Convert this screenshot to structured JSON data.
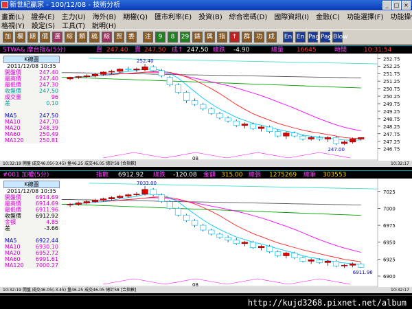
{
  "window": {
    "title": "新世紀贏家 - 100/12/08 - 技術分析",
    "buttons": [
      "_",
      "□",
      "×"
    ]
  },
  "menu": {
    "row1": [
      "畫面(L)",
      "證券(E)",
      "主力(U)",
      "海外(B)",
      "期權(Q)",
      "匯市利率(E)",
      "投資(B)",
      "綜合密碼(D)",
      "國際資訊(I)",
      "金融(C)",
      "功能選擇(F)",
      "功能操作(K)"
    ],
    "row2": [
      "格視(Y)",
      "設定(S)",
      "工具(T)",
      "說明(H)"
    ]
  },
  "toolbar": {
    "buttons": [
      "加",
      "欄",
      "期",
      "價",
      "選",
      "綜",
      "類",
      "稿",
      "綜",
      "贸",
      "委",
      "注",
      "9",
      "8",
      "29",
      "錶",
      "興",
      "指",
      "↑",
      "群",
      "功",
      "成",
      "En",
      "En",
      "Page",
      "Page",
      "Blow"
    ]
  },
  "colors": {
    "up": "#ff2020",
    "down": "#0030c0",
    "ma5": "#00c8ff",
    "ma10": "#ff2a2a",
    "ma20": "#ff00ff",
    "ma60": "#00c000",
    "ma120": "#888888",
    "bg": "#ffffff"
  },
  "panel1": {
    "header": {
      "symbol": "STWA& 摩台指&(5分)",
      "buy_label": "買",
      "buy": "247.40",
      "sell_label": "賣",
      "sell": "247.50",
      "last_label": "成↑",
      "last": "247.50",
      "chg_label": "總跌",
      "chg": "-4.90",
      "vol_label": "總量",
      "vol": "16645",
      "time_label": "時間",
      "time": "10:31:54"
    },
    "info": {
      "title": "K線圖",
      "date": "2011/12/08 10:35",
      "rows": [
        {
          "label": "開盤價",
          "value": "247.40",
          "color": "#d000d0"
        },
        {
          "label": "最高價",
          "value": "247.40",
          "color": "#d000d0"
        },
        {
          "label": "最低價",
          "value": "247.30",
          "color": "#d000d0"
        },
        {
          "label": "收盤價",
          "value": "247.50",
          "color": "#00a0a0"
        },
        {
          "label": "成交量",
          "value": "96",
          "color": "#d000d0"
        },
        {
          "label": "差",
          "value": "0.10",
          "color": "#00a0a0"
        },
        {
          "label": "",
          "value": "",
          "color": "#000"
        },
        {
          "label": "MA5",
          "value": "247.50",
          "color": "#0000c0"
        },
        {
          "label": "MA10",
          "value": "247.70",
          "color": "#d000d0"
        },
        {
          "label": "MA20",
          "value": "248.39",
          "color": "#d000d0"
        },
        {
          "label": "MA60",
          "value": "250.49",
          "color": "#d000d0"
        },
        {
          "label": "MA120",
          "value": "250.81",
          "color": "#d000d0"
        }
      ]
    },
    "yticks": [
      "252.75",
      "252.25",
      "251.75",
      "251.25",
      "250.75",
      "250.25",
      "249.75",
      "249.25",
      "248.75",
      "248.25",
      "247.75",
      "247.25",
      "246.75"
    ],
    "ymin": 246.6,
    "ymax": 252.9,
    "high_label": "252.40",
    "low_label": "247.00",
    "x_label": "08",
    "status": "10:32:19 開盤 成交46.05(-3.45) 量46.25 成交46.05 總計58 [合指數]",
    "status_right": "10:32:17"
  },
  "panel2": {
    "header": {
      "symbol": "#001 加權(5分)",
      "idx_label": "指數",
      "idx": "6912.92",
      "chg_label": "總跌",
      "chg": "-120.08",
      "amt_label": "金額",
      "amt": "315.00",
      "vol_label": "總張",
      "vol": "1275269",
      "cnt_label": "總筆",
      "cnt": "303553"
    },
    "info": {
      "title": "K線圖",
      "date": "2011/12/08 10:35",
      "rows": [
        {
          "label": "開盤價",
          "value": "6914.69",
          "color": "#d000d0"
        },
        {
          "label": "最高價",
          "value": "6914.69",
          "color": "#d000d0"
        },
        {
          "label": "最低價",
          "value": "6911.96",
          "color": "#d000d0"
        },
        {
          "label": "收盤價",
          "value": "6912.92",
          "color": "#000"
        },
        {
          "label": "金額",
          "value": "4.85",
          "color": "#d000d0"
        },
        {
          "label": "差",
          "value": "-3.66",
          "color": "#000"
        },
        {
          "label": "",
          "value": "",
          "color": "#000"
        },
        {
          "label": "MA5",
          "value": "6922.44",
          "color": "#0000c0"
        },
        {
          "label": "MA10",
          "value": "6930.10",
          "color": "#d000d0"
        },
        {
          "label": "MA20",
          "value": "6952.72",
          "color": "#d000d0"
        },
        {
          "label": "MA60",
          "value": "6991.61",
          "color": "#d000d0"
        },
        {
          "label": "MA120",
          "value": "7000.27",
          "color": "#d000d0"
        }
      ]
    },
    "yticks": [
      "7025",
      "7000",
      "6975",
      "6950",
      "6925",
      "6900"
    ],
    "ymin": 6898,
    "ymax": 7040,
    "high_label": "7033.00",
    "low_label": "6911.96",
    "x_label": "08",
    "status": "10:32:19 開盤 成交46.05(-3.45) 量46.25 成交46.05 總計58 [合指數]",
    "status_right": "10:32:17"
  },
  "footer": {
    "url": "http://kujd3268.pixnet.net/album"
  },
  "chart_data": [
    {
      "type": "candlestick",
      "title": "STWA& 摩台指&(5分)",
      "candles": [
        [
          251.4,
          251.55,
          251.3,
          251.5
        ],
        [
          251.5,
          251.6,
          251.4,
          251.55
        ],
        [
          251.55,
          251.7,
          251.45,
          251.6
        ],
        [
          251.6,
          251.8,
          251.5,
          251.7
        ],
        [
          251.7,
          251.9,
          251.6,
          251.85
        ],
        [
          251.85,
          252.0,
          251.7,
          251.9
        ],
        [
          251.9,
          252.1,
          251.8,
          252.05
        ],
        [
          252.05,
          252.2,
          251.9,
          252.0
        ],
        [
          252.0,
          252.15,
          251.85,
          252.05
        ],
        [
          252.0,
          252.4,
          251.9,
          252.2
        ],
        [
          252.2,
          252.3,
          251.9,
          251.95
        ],
        [
          251.95,
          252.05,
          251.5,
          251.6
        ],
        [
          251.5,
          251.6,
          250.9,
          251.0
        ],
        [
          251.0,
          251.1,
          250.4,
          250.5
        ],
        [
          250.5,
          250.6,
          249.8,
          249.95
        ],
        [
          249.95,
          250.1,
          249.6,
          249.7
        ],
        [
          249.7,
          249.8,
          249.3,
          249.4
        ],
        [
          249.4,
          249.5,
          249.0,
          249.1
        ],
        [
          249.1,
          249.2,
          248.7,
          248.8
        ],
        [
          248.8,
          248.9,
          248.5,
          248.6
        ],
        [
          248.6,
          248.7,
          248.2,
          248.3
        ],
        [
          248.3,
          248.5,
          248.1,
          248.4
        ],
        [
          248.4,
          248.5,
          248.0,
          248.1
        ],
        [
          248.1,
          248.3,
          247.9,
          248.2
        ],
        [
          248.2,
          248.3,
          247.8,
          247.9
        ],
        [
          247.9,
          248.0,
          247.5,
          247.6
        ],
        [
          247.6,
          247.9,
          247.4,
          247.8
        ],
        [
          247.8,
          247.9,
          247.5,
          247.6
        ],
        [
          247.6,
          247.7,
          247.3,
          247.4
        ],
        [
          247.4,
          247.6,
          247.3,
          247.5
        ],
        [
          247.5,
          247.6,
          247.3,
          247.4
        ],
        [
          247.4,
          247.6,
          247.2,
          247.5
        ],
        [
          247.5,
          247.6,
          247.0,
          247.1
        ],
        [
          247.1,
          247.3,
          247.0,
          247.2
        ],
        [
          247.2,
          247.5,
          247.1,
          247.4
        ],
        [
          247.4,
          247.5,
          247.3,
          247.5
        ]
      ]
    },
    {
      "type": "candlestick",
      "title": "#001 加權(5分)",
      "candles": [
        [
          7005,
          7008,
          7002,
          7006
        ],
        [
          7006,
          7010,
          7004,
          7008
        ],
        [
          7008,
          7012,
          7006,
          7010
        ],
        [
          7010,
          7014,
          7008,
          7012
        ],
        [
          7012,
          7016,
          7010,
          7014
        ],
        [
          7014,
          7018,
          7012,
          7016
        ],
        [
          7016,
          7020,
          7014,
          7018
        ],
        [
          7018,
          7022,
          7016,
          7020
        ],
        [
          7020,
          7024,
          7018,
          7021
        ],
        [
          7021,
          7033,
          7019,
          7028
        ],
        [
          7028,
          7030,
          7018,
          7020
        ],
        [
          7020,
          7022,
          7008,
          7010
        ],
        [
          7010,
          7012,
          6998,
          7000
        ],
        [
          7000,
          7002,
          6988,
          6990
        ],
        [
          6990,
          6992,
          6980,
          6982
        ],
        [
          6982,
          6984,
          6972,
          6975
        ],
        [
          6975,
          6977,
          6966,
          6968
        ],
        [
          6968,
          6970,
          6960,
          6962
        ],
        [
          6962,
          6964,
          6955,
          6957
        ],
        [
          6957,
          6960,
          6950,
          6953
        ],
        [
          6953,
          6956,
          6946,
          6948
        ],
        [
          6948,
          6952,
          6944,
          6950
        ],
        [
          6950,
          6952,
          6940,
          6942
        ],
        [
          6942,
          6946,
          6938,
          6944
        ],
        [
          6944,
          6946,
          6934,
          6936
        ],
        [
          6936,
          6938,
          6928,
          6930
        ],
        [
          6930,
          6936,
          6926,
          6934
        ],
        [
          6934,
          6936,
          6925,
          6927
        ],
        [
          6927,
          6929,
          6920,
          6922
        ],
        [
          6922,
          6926,
          6918,
          6924
        ],
        [
          6924,
          6926,
          6918,
          6920
        ],
        [
          6920,
          6924,
          6915,
          6922
        ],
        [
          6922,
          6924,
          6913,
          6915
        ],
        [
          6915,
          6918,
          6912,
          6916
        ],
        [
          6916,
          6920,
          6913,
          6918
        ],
        [
          6918,
          6920,
          6911.96,
          6912.92
        ]
      ]
    }
  ]
}
